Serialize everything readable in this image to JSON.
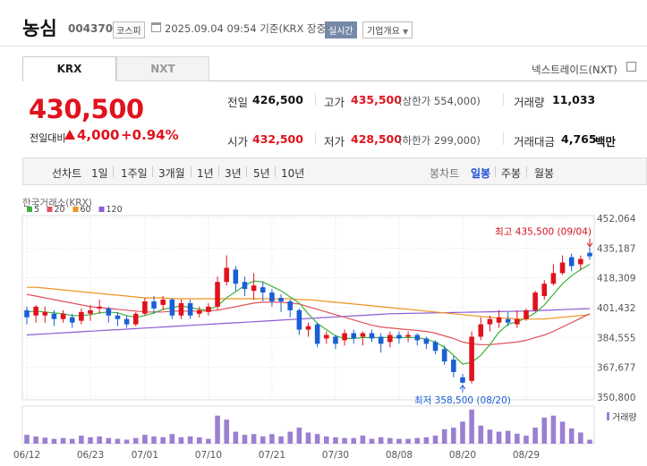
{
  "header": {
    "stock_name": "농심",
    "stock_code": "004370",
    "market_badge": "코스피",
    "datetime": "2025.09.04 09:54 기준(KRX 장중)",
    "realtime_badge": "실시간",
    "company_info_button": "기업개요"
  },
  "tabs": [
    {
      "label": "KRX",
      "active": true
    },
    {
      "label": "NXT",
      "active": false
    }
  ],
  "nxt_link": "넥스트레이드(NXT)",
  "price": {
    "current": "430,500",
    "change_label": "전일대비",
    "change": "4,000",
    "change_pct": "+0.94%",
    "direction": "up"
  },
  "quote": {
    "prev_close_label": "전일",
    "prev_close": "426,500",
    "high_label": "고가",
    "high": "435,500",
    "upper_limit": "(상한가 554,000)",
    "volume_label": "거래량",
    "volume": "11,033",
    "open_label": "시가",
    "open": "432,500",
    "low_label": "저가",
    "low": "428,500",
    "lower_limit": "(하한가 299,000)",
    "value_label": "거래대금",
    "value": "4,765",
    "value_unit": "백만"
  },
  "range_bar": {
    "line_label": "선차트",
    "ranges": [
      "1일",
      "1주일",
      "3개월",
      "1년",
      "3년",
      "5년",
      "10년"
    ],
    "candle_label": "봉차트",
    "candle_ranges": [
      {
        "label": "일봉",
        "active": true
      },
      {
        "label": "주봉",
        "active": false
      },
      {
        "label": "월봉",
        "active": false
      }
    ]
  },
  "chart_data": {
    "type": "candlestick",
    "source_label": "한국거래소(KRX)",
    "ma_legend": [
      {
        "label": "5",
        "color": "#3bb23b"
      },
      {
        "label": "20",
        "color": "#e0525a"
      },
      {
        "label": "60",
        "color": "#f0921e"
      },
      {
        "label": "120",
        "color": "#8c5bd6"
      }
    ],
    "y_ticks": [
      "452,064",
      "435,187",
      "418,309",
      "401,432",
      "384,555",
      "367,677",
      "350,800"
    ],
    "ylim": [
      350800,
      452064
    ],
    "x_ticks": [
      {
        "label": "06/12",
        "index": 0
      },
      {
        "label": "06/23",
        "index": 7
      },
      {
        "label": "07/01",
        "index": 13
      },
      {
        "label": "07/10",
        "index": 20
      },
      {
        "label": "07/21",
        "index": 27
      },
      {
        "label": "07/30",
        "index": 34
      },
      {
        "label": "08/08",
        "index": 41
      },
      {
        "label": "08/20",
        "index": 48
      },
      {
        "label": "08/29",
        "index": 55
      }
    ],
    "max_annotation": "최고 435,500 (09/04)",
    "min_annotation": "최저 358,500 (08/20)",
    "volume_label": "거래량",
    "candles": [
      [
        400000,
        396000,
        392000,
        402000
      ],
      [
        397000,
        402000,
        393000,
        403000
      ],
      [
        397000,
        399000,
        393000,
        402000
      ],
      [
        398000,
        395000,
        391000,
        400000
      ],
      [
        395000,
        398000,
        393000,
        400000
      ],
      [
        396000,
        393000,
        390000,
        398000
      ],
      [
        394000,
        399000,
        392000,
        401000
      ],
      [
        398000,
        400000,
        394000,
        403000
      ],
      [
        401000,
        402000,
        398000,
        406000
      ],
      [
        401000,
        397000,
        393000,
        402000
      ],
      [
        397000,
        395000,
        391000,
        399000
      ],
      [
        395000,
        392000,
        390000,
        397000
      ],
      [
        392000,
        398000,
        391000,
        399000
      ],
      [
        398000,
        405000,
        397000,
        407000
      ],
      [
        405000,
        401000,
        398000,
        408000
      ],
      [
        403000,
        406000,
        400000,
        408000
      ],
      [
        406000,
        397000,
        395000,
        407000
      ],
      [
        397000,
        404000,
        395000,
        406000
      ],
      [
        404000,
        397000,
        395000,
        406000
      ],
      [
        398000,
        400000,
        396000,
        402000
      ],
      [
        399000,
        402000,
        397000,
        404000
      ],
      [
        402000,
        416000,
        400000,
        419000
      ],
      [
        416000,
        424000,
        414000,
        431000
      ],
      [
        423000,
        415000,
        411000,
        425000
      ],
      [
        416000,
        412000,
        408000,
        419000
      ],
      [
        411000,
        414000,
        406000,
        421000
      ],
      [
        413000,
        410000,
        405000,
        416000
      ],
      [
        410000,
        405000,
        402000,
        412000
      ],
      [
        407000,
        405000,
        399000,
        409000
      ],
      [
        405000,
        400000,
        396000,
        406000
      ],
      [
        400000,
        389000,
        386000,
        401000
      ],
      [
        389000,
        391000,
        385000,
        393000
      ],
      [
        392000,
        381000,
        379000,
        393000
      ],
      [
        384000,
        386000,
        381000,
        388000
      ],
      [
        385000,
        381000,
        378000,
        386000
      ],
      [
        383000,
        387000,
        380000,
        389000
      ],
      [
        387000,
        384000,
        381000,
        389000
      ],
      [
        385000,
        387000,
        380000,
        388000
      ],
      [
        387000,
        384000,
        382000,
        389000
      ],
      [
        385000,
        381000,
        376000,
        387000
      ],
      [
        382000,
        386000,
        379000,
        388000
      ],
      [
        386000,
        384000,
        381000,
        388000
      ],
      [
        385000,
        386000,
        382000,
        388000
      ],
      [
        386000,
        383000,
        380000,
        387000
      ],
      [
        384000,
        381000,
        378000,
        385000
      ],
      [
        382000,
        377000,
        375000,
        383000
      ],
      [
        378000,
        371000,
        369000,
        380000
      ],
      [
        372000,
        365000,
        362000,
        374000
      ],
      [
        362000,
        359000,
        358500,
        364000
      ],
      [
        360000,
        385000,
        358500,
        388000
      ],
      [
        385000,
        392000,
        383000,
        396000
      ],
      [
        392000,
        395000,
        388000,
        397000
      ],
      [
        393000,
        396000,
        390000,
        400000
      ],
      [
        395000,
        393000,
        391000,
        399000
      ],
      [
        392000,
        395000,
        390000,
        400000
      ],
      [
        395000,
        400000,
        394000,
        401000
      ],
      [
        400000,
        410000,
        399000,
        411000
      ],
      [
        408000,
        415000,
        406000,
        417000
      ],
      [
        415000,
        421000,
        414000,
        426000
      ],
      [
        421000,
        427000,
        420000,
        431000
      ],
      [
        430000,
        425000,
        422000,
        432000
      ],
      [
        426000,
        429000,
        423000,
        431000
      ],
      [
        432500,
        430500,
        428500,
        435500
      ]
    ],
    "ma": {
      "5": [
        399000,
        399500,
        399000,
        398500,
        398000,
        397000,
        397000,
        397500,
        398500,
        399000,
        398500,
        397000,
        396000,
        397000,
        398500,
        400500,
        401500,
        402500,
        401500,
        400500,
        400000,
        402500,
        407000,
        410500,
        414000,
        416500,
        416000,
        413500,
        411000,
        407500,
        404000,
        398000,
        392500,
        389000,
        385500,
        384000,
        384000,
        384500,
        384500,
        384500,
        384500,
        384500,
        384500,
        384500,
        383500,
        382000,
        379000,
        374500,
        369500,
        370500,
        374500,
        380500,
        387500,
        392000,
        393500,
        395500,
        398500,
        403000,
        409000,
        415000,
        419500,
        423000,
        426000
      ],
      "20": [
        409000,
        408000,
        407000,
        406000,
        405000,
        404000,
        403000,
        402000,
        401500,
        401000,
        400500,
        400000,
        399500,
        399000,
        399000,
        399000,
        399500,
        399500,
        399500,
        399500,
        399500,
        400000,
        401000,
        402000,
        403000,
        404000,
        404500,
        404500,
        404500,
        404000,
        403500,
        402000,
        400500,
        399000,
        397500,
        396000,
        394500,
        393000,
        391500,
        390500,
        390000,
        389500,
        389000,
        388500,
        388000,
        387000,
        385500,
        384000,
        382000,
        381000,
        380500,
        380500,
        381000,
        381500,
        382000,
        383000,
        384500,
        386000,
        388000,
        390500,
        393000,
        395500,
        398000
      ],
      "60": [
        413000,
        413000,
        412500,
        412000,
        411500,
        411000,
        410500,
        410000,
        409500,
        409000,
        408500,
        408000,
        407500,
        407000,
        407000,
        407000,
        406500,
        406500,
        406500,
        406500,
        406500,
        406500,
        406500,
        406500,
        406500,
        406500,
        406500,
        406500,
        406500,
        406500,
        406000,
        406000,
        405500,
        405000,
        404500,
        404000,
        403500,
        403000,
        402500,
        402000,
        401500,
        401000,
        400500,
        400000,
        399500,
        399000,
        398500,
        398000,
        397500,
        397000,
        396500,
        396000,
        395500,
        395500,
        395000,
        395000,
        395000,
        395000,
        395500,
        396000,
        396500,
        397000,
        397500
      ],
      "120": [
        386000,
        386300,
        386600,
        386900,
        387200,
        387500,
        387800,
        388100,
        388400,
        388700,
        389000,
        389300,
        389600,
        389900,
        390200,
        390500,
        390800,
        391100,
        391400,
        391700,
        392000,
        392300,
        392600,
        392900,
        393200,
        393500,
        393800,
        394100,
        394400,
        394700,
        395000,
        395300,
        395600,
        395900,
        396200,
        396500,
        396800,
        397100,
        397400,
        397700,
        398000,
        398100,
        398200,
        398300,
        398400,
        398500,
        398600,
        398700,
        398800,
        398900,
        399000,
        399100,
        399200,
        399300,
        399400,
        399500,
        399700,
        399900,
        400100,
        400300,
        400500,
        400700,
        400900
      ]
    },
    "volumes": [
      22,
      18,
      15,
      12,
      14,
      12,
      20,
      16,
      18,
      14,
      12,
      10,
      14,
      22,
      18,
      16,
      24,
      16,
      18,
      16,
      12,
      70,
      60,
      30,
      22,
      24,
      18,
      24,
      18,
      30,
      40,
      28,
      24,
      18,
      16,
      14,
      14,
      20,
      12,
      16,
      14,
      12,
      12,
      14,
      16,
      20,
      36,
      40,
      55,
      85,
      45,
      35,
      30,
      32,
      25,
      20,
      40,
      65,
      70,
      55,
      38,
      28,
      10
    ]
  }
}
